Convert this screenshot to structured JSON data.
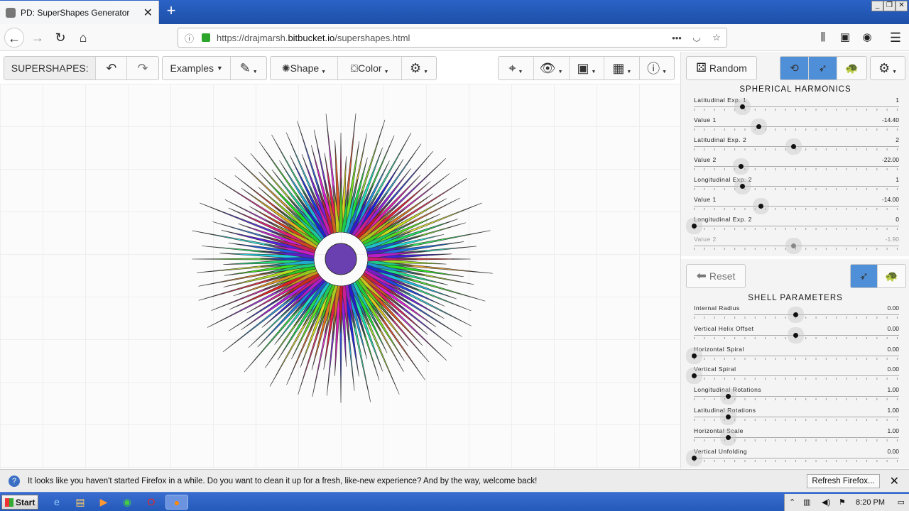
{
  "browser": {
    "tab_title": "PD: SuperShapes Generator",
    "url_prefix": "https://drajmarsh.",
    "url_domain": "bitbucket.io",
    "url_path": "/supershapes.html"
  },
  "toolbar": {
    "app_label": "SUPERSHAPES:",
    "examples_label": "Examples",
    "shape_label": "Shape",
    "color_label": "Color",
    "random_label": "Random",
    "reset_label": "Reset"
  },
  "spherical": {
    "title": "SPHERICAL HARMONICS",
    "rows": [
      {
        "label": "Latitudinal Exp. 1",
        "value": "1",
        "pos": 0.24
      },
      {
        "label": "Value 1",
        "value": "-14.40",
        "pos": 0.32
      },
      {
        "label": "Latitudinal Exp. 2",
        "value": "2",
        "pos": 0.49
      },
      {
        "label": "Value 2",
        "value": "-22.00",
        "pos": 0.23
      },
      {
        "label": "Longitudinal Exp. 2",
        "value": "1",
        "pos": 0.24
      },
      {
        "label": "Value 1",
        "value": "-14.00",
        "pos": 0.33
      },
      {
        "label": "Longitudinal Exp. 2",
        "value": "0",
        "pos": 0.0
      },
      {
        "label": "Value 2",
        "value": "-1.90",
        "pos": 0.49,
        "disabled": true
      }
    ]
  },
  "shell": {
    "title": "SHELL PARAMETERS",
    "rows": [
      {
        "label": "Internal Radius",
        "value": "0.00",
        "pos": 0.5
      },
      {
        "label": "Vertical Helix Offset",
        "value": "0.00",
        "pos": 0.5
      },
      {
        "label": "Horizontal Spiral",
        "value": "0.00",
        "pos": 0.0
      },
      {
        "label": "Vertical Spiral",
        "value": "0.00",
        "pos": 0.0
      },
      {
        "label": "Longitudinal Rotations",
        "value": "1.00",
        "pos": 0.17
      },
      {
        "label": "Latitudinal Rotations",
        "value": "1.00",
        "pos": 0.17
      },
      {
        "label": "Horizontal Scale",
        "value": "1.00",
        "pos": 0.17
      },
      {
        "label": "Vertical Unfolding",
        "value": "0.00",
        "pos": 0.0
      }
    ]
  },
  "notification": {
    "message": "It looks like you haven't started Firefox in a while. Do you want to clean it up for a fresh, like-new experience? And by the way, welcome back!",
    "button": "Refresh Firefox..."
  },
  "taskbar": {
    "start_label": "Start",
    "clock": "8:20 PM"
  },
  "colors": {
    "accent": "#4f8fd8",
    "taskbar": "#245ab9"
  }
}
